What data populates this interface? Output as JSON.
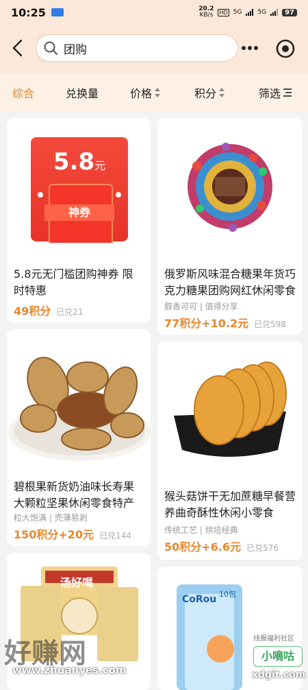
{
  "status": {
    "time": "10:25",
    "speed_value": "20.2",
    "speed_unit": "KB/s",
    "hd_label": "HD",
    "signal1": "5G",
    "signal2": "5G",
    "battery": "97"
  },
  "search": {
    "query": "团购",
    "placeholder": "团购"
  },
  "filters": [
    {
      "label": "综合",
      "active": true
    },
    {
      "label": "兑换量"
    },
    {
      "label": "价格"
    },
    {
      "label": "积分"
    },
    {
      "label": "筛选"
    }
  ],
  "products": [
    {
      "title": "5.8元无门槛团购神券 限时特惠",
      "price": "49积分",
      "sold": "已兑21",
      "coupon_amount": "5.8",
      "coupon_unit": "元",
      "coupon_band": "神券"
    },
    {
      "title": "俄罗斯风味混合糖果年货巧克力糖果团购网红休闲零食",
      "tags": "醇香可可 | 值得分享",
      "price": "77积分+10.2元",
      "sold": "已兑598"
    },
    {
      "title": "碧根果新货奶油味长寿果大颗粒坚果休闲零食特产",
      "tags": "粒大饱满 | 壳薄易剥",
      "price": "150积分+20元",
      "sold": "已兑144"
    },
    {
      "title": "猴头菇饼干无加蔗糖早餐营养曲奇酥性休闲小零食",
      "tags": "传统工艺 | 烘培经典",
      "price": "50积分+6.6元",
      "sold": "已兑576"
    },
    {
      "package_text": "汤好喝"
    },
    {
      "brand_text": "CoRou",
      "count_text": "10包"
    }
  ],
  "watermarks": {
    "left_main": "好赚网",
    "left_url": "www.zhuanyes.com",
    "right_main": "小嘀咕",
    "right_url": "xdgit.com",
    "right_sub": "线报福利社区"
  },
  "colors": {
    "accent": "#e8862a",
    "header_bg": "#fbe8d8"
  }
}
